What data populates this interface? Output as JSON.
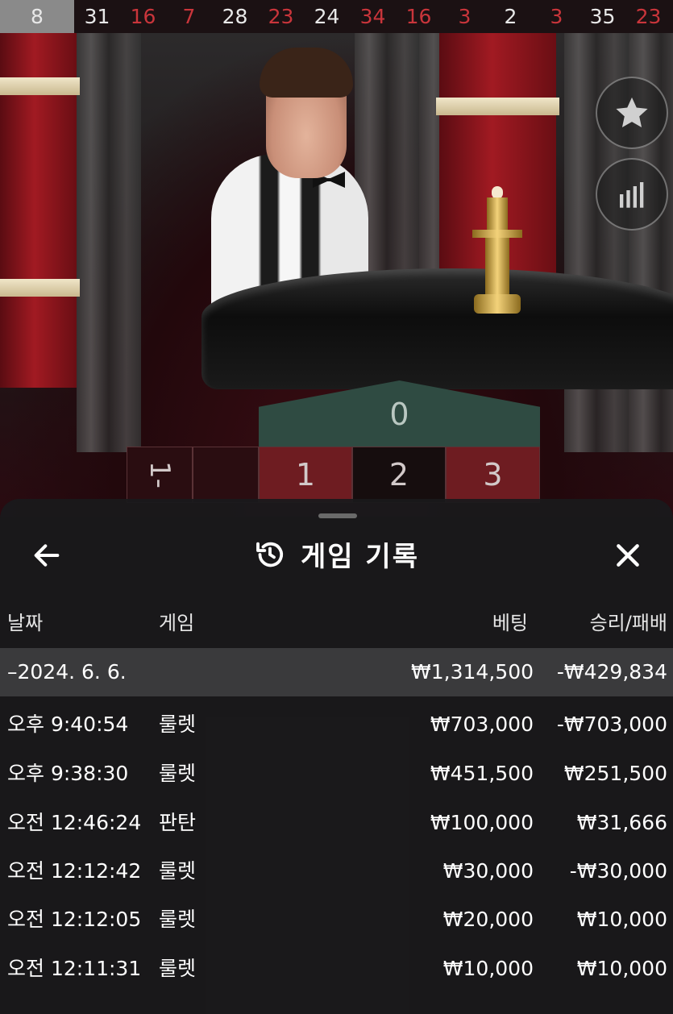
{
  "recent_numbers": [
    {
      "value": "8",
      "color": "black",
      "latest": true
    },
    {
      "value": "31",
      "color": "black"
    },
    {
      "value": "16",
      "color": "red"
    },
    {
      "value": "7",
      "color": "red"
    },
    {
      "value": "28",
      "color": "black"
    },
    {
      "value": "23",
      "color": "red"
    },
    {
      "value": "24",
      "color": "black"
    },
    {
      "value": "34",
      "color": "red"
    },
    {
      "value": "16",
      "color": "red"
    },
    {
      "value": "3",
      "color": "red"
    },
    {
      "value": "2",
      "color": "black"
    },
    {
      "value": "3",
      "color": "red"
    },
    {
      "value": "35",
      "color": "black"
    },
    {
      "value": "23",
      "color": "red"
    }
  ],
  "side_buttons": {
    "favorite_icon": "star-icon",
    "stats_icon": "bar-chart-icon"
  },
  "board": {
    "zero": "0",
    "cells": [
      "1",
      "2",
      "3"
    ],
    "side_label": "1-"
  },
  "history_panel": {
    "title": "게임 기록",
    "title_icon": "history-icon",
    "back_icon": "arrow-left-icon",
    "close_icon": "close-icon",
    "columns": {
      "date": "날짜",
      "game": "게임",
      "bet": "베팅",
      "win_loss": "승리/패배"
    },
    "date_group": {
      "date": "–2024. 6. 6.",
      "bet": "₩1,314,500",
      "win_loss": "-₩429,834"
    },
    "rows": [
      {
        "time": "오후 9:40:54",
        "game": "룰렛",
        "bet": "₩703,000",
        "win_loss": "-₩703,000"
      },
      {
        "time": "오후 9:38:30",
        "game": "룰렛",
        "bet": "₩451,500",
        "win_loss": "₩251,500"
      },
      {
        "time": "오전 12:46:24",
        "game": "판탄",
        "bet": "₩100,000",
        "win_loss": "₩31,666"
      },
      {
        "time": "오전 12:12:42",
        "game": "룰렛",
        "bet": "₩30,000",
        "win_loss": "-₩30,000"
      },
      {
        "time": "오전 12:12:05",
        "game": "룰렛",
        "bet": "₩20,000",
        "win_loss": "₩10,000"
      },
      {
        "time": "오전 12:11:31",
        "game": "룰렛",
        "bet": "₩10,000",
        "win_loss": "₩10,000"
      }
    ]
  },
  "colors": {
    "red_number": "#c9353b",
    "panel_bg": "#1a1a1c",
    "date_row_bg": "#3a3a3c"
  }
}
